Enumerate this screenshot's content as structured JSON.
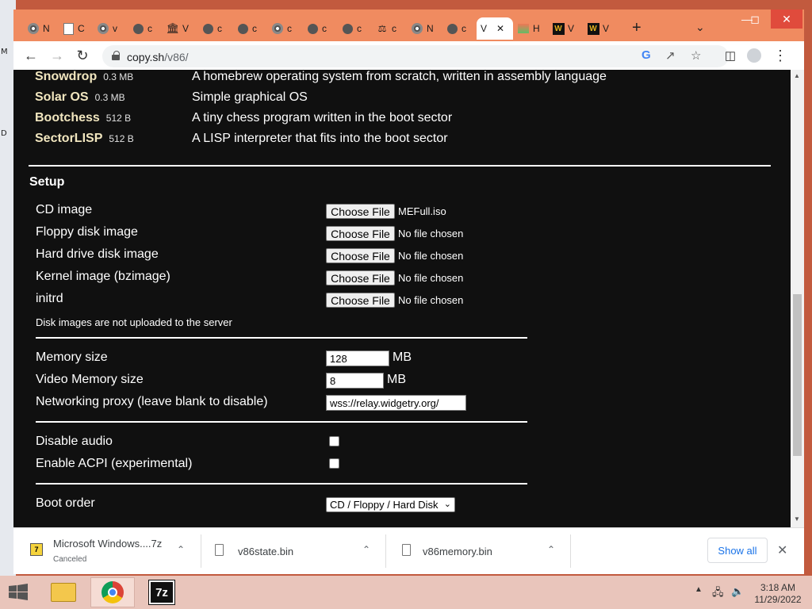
{
  "browser": {
    "tabs": [
      {
        "letter": "N",
        "icon": "chrome-icon"
      },
      {
        "letter": "C",
        "icon": "page-icon"
      },
      {
        "letter": "v",
        "icon": "chrome-icon"
      },
      {
        "letter": "c",
        "icon": "globe-icon"
      },
      {
        "letter": "V",
        "icon": "bank-icon"
      },
      {
        "letter": "c",
        "icon": "globe-icon"
      },
      {
        "letter": "c",
        "icon": "globe-icon"
      },
      {
        "letter": "c",
        "icon": "chrome-icon"
      },
      {
        "letter": "c",
        "icon": "globe-icon"
      },
      {
        "letter": "c",
        "icon": "globe-icon"
      },
      {
        "letter": "c",
        "icon": "puzzle-icon"
      },
      {
        "letter": "N",
        "icon": "chrome-icon"
      },
      {
        "letter": "c",
        "icon": "globe-icon"
      },
      {
        "letter": "V",
        "icon": "none",
        "active": true
      },
      {
        "letter": "H",
        "icon": "image-icon"
      },
      {
        "letter": "V",
        "icon": "w-icon"
      },
      {
        "letter": "V",
        "icon": "w-icon"
      }
    ],
    "new_tab": "+",
    "url_host": "copy.sh",
    "url_path": "/v86/"
  },
  "os_list": [
    {
      "name": "Snowdrop",
      "size": "0.3 MB",
      "desc": "A homebrew operating system from scratch, written in assembly language"
    },
    {
      "name": "Solar OS",
      "size": "0.3 MB",
      "desc": "Simple graphical OS"
    },
    {
      "name": "Bootchess",
      "size": "512 B",
      "desc": "A tiny chess program written in the boot sector"
    },
    {
      "name": "SectorLISP",
      "size": "512 B",
      "desc": "A LISP interpreter that fits into the boot sector"
    }
  ],
  "setup": {
    "title": "Setup",
    "files": [
      {
        "label": "CD image",
        "button": "Choose File",
        "status": "MEFull.iso"
      },
      {
        "label": "Floppy disk image",
        "button": "Choose File",
        "status": "No file chosen"
      },
      {
        "label": "Hard drive disk image",
        "button": "Choose File",
        "status": "No file chosen"
      },
      {
        "label": "Kernel image (bzimage)",
        "button": "Choose File",
        "status": "No file chosen"
      },
      {
        "label": "initrd",
        "button": "Choose File",
        "status": "No file chosen"
      }
    ],
    "note": "Disk images are not uploaded to the server",
    "memory_label": "Memory size",
    "memory_value": "128",
    "memory_unit": "MB",
    "vmem_label": "Video Memory size",
    "vmem_value": "8",
    "vmem_unit": "MB",
    "proxy_label": "Networking proxy (leave blank to disable)",
    "proxy_value": "wss://relay.widgetry.org/",
    "audio_label": "Disable audio",
    "audio_checked": false,
    "acpi_label": "Enable ACPI (experimental)",
    "acpi_checked": false,
    "boot_label": "Boot order",
    "boot_value": "CD / Floppy / Hard Disk"
  },
  "downloads": {
    "items": [
      {
        "name": "Microsoft Windows....7z",
        "status": "Canceled"
      },
      {
        "name": "v86state.bin",
        "status": ""
      },
      {
        "name": "v86memory.bin",
        "status": ""
      }
    ],
    "show_all": "Show all"
  },
  "taskbar": {
    "sevenzip_label": "7z",
    "time": "3:18 AM",
    "date": "11/29/2022"
  }
}
